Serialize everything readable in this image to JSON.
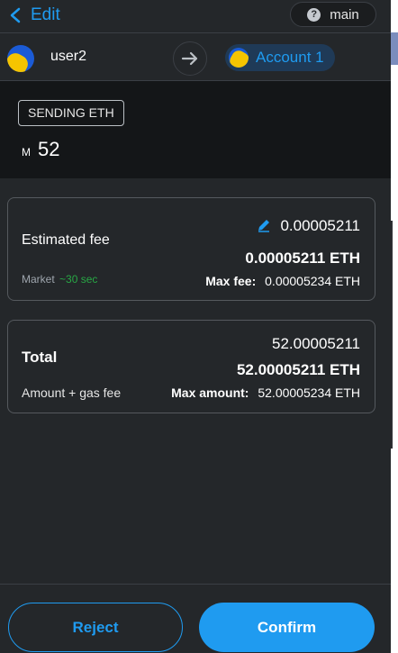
{
  "header": {
    "back_label": "Edit",
    "network_label": "main",
    "network_icon": "question-icon"
  },
  "accounts": {
    "from_name": "user2",
    "to_name": "Account 1"
  },
  "sending": {
    "badge": "SENDING ETH",
    "currency_mark": "M",
    "amount": "52"
  },
  "fee": {
    "title": "Estimated fee",
    "speed_label": "Market",
    "speed_time": "~30 sec",
    "primary_value": "0.00005211",
    "eth_value": "0.00005211 ETH",
    "max_label": "Max fee:",
    "max_value": "0.00005234 ETH"
  },
  "total": {
    "title": "Total",
    "subtitle": "Amount + gas fee",
    "primary_value": "52.00005211",
    "eth_value": "52.00005211 ETH",
    "max_label": "Max amount:",
    "max_value": "52.00005234 ETH"
  },
  "footer": {
    "reject_label": "Reject",
    "confirm_label": "Confirm"
  },
  "colors": {
    "accent": "#1f9bf0",
    "background": "#24272a",
    "success": "#28a745"
  }
}
